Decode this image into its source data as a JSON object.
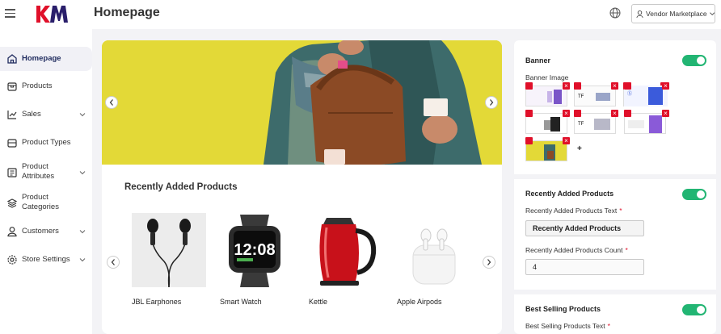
{
  "header": {
    "title": "Homepage",
    "vendor_label": "Vendor Marketplace",
    "brand_color": "#e0102a"
  },
  "sidebar": {
    "items": [
      {
        "label": "Homepage",
        "icon": "home-icon",
        "active": true
      },
      {
        "label": "Products",
        "icon": "box-icon"
      },
      {
        "label": "Sales",
        "icon": "chart-icon",
        "expandable": true
      },
      {
        "label": "Product Types",
        "icon": "tag-icon"
      },
      {
        "label": "Product Attributes",
        "icon": "sliders-icon",
        "expandable": true
      },
      {
        "label": "Product Categories",
        "icon": "layers-icon"
      },
      {
        "label": "Customers",
        "icon": "user-icon",
        "expandable": true
      },
      {
        "label": "Store Settings",
        "icon": "gear-icon",
        "expandable": true
      }
    ]
  },
  "main": {
    "recent_title": "Recently Added Products",
    "products": [
      {
        "name": "JBL Earphones"
      },
      {
        "name": "Smart Watch"
      },
      {
        "name": "Kettle"
      },
      {
        "name": "Apple Airpods"
      }
    ]
  },
  "panel": {
    "banner": {
      "title": "Banner",
      "enabled": true,
      "image_label": "Banner Image",
      "thumb_count": 7
    },
    "recent": {
      "title": "Recently Added Products",
      "enabled": true,
      "text_label": "Recently Added Products Text",
      "text_value": "Recently Added Products",
      "count_label": "Recently Added Products Count",
      "count_value": "4"
    },
    "best": {
      "title": "Best Selling Products",
      "enabled": true,
      "text_label": "Best Selling Products Text"
    },
    "toggle_color": "#22b573"
  }
}
